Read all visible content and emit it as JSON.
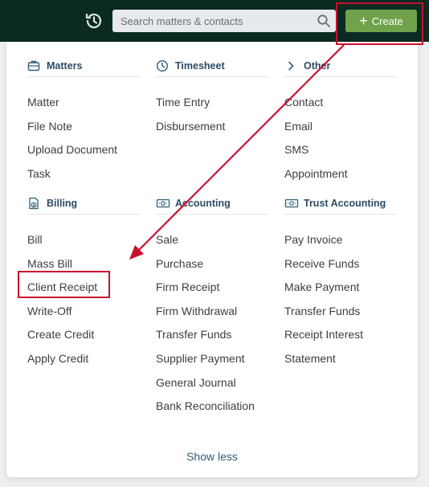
{
  "header": {
    "search_placeholder": "Search matters & contacts",
    "create_label": "Create"
  },
  "sections": {
    "matters": {
      "title": "Matters",
      "icon": "briefcase-icon",
      "items": [
        "Matter",
        "File Note",
        "Upload Document",
        "Task"
      ]
    },
    "timesheet": {
      "title": "Timesheet",
      "icon": "clock-icon",
      "items": [
        "Time Entry",
        "Disbursement"
      ]
    },
    "other": {
      "title": "Other",
      "icon": "chevron-right-icon",
      "items": [
        "Contact",
        "Email",
        "SMS",
        "Appointment"
      ]
    },
    "billing": {
      "title": "Billing",
      "icon": "invoice-dollar-icon",
      "items": [
        "Bill",
        "Mass Bill",
        "Client Receipt",
        "Write-Off",
        "Create Credit",
        "Apply Credit"
      ]
    },
    "accounting": {
      "title": "Accounting",
      "icon": "banknote-icon",
      "items": [
        "Sale",
        "Purchase",
        "Firm Receipt",
        "Firm Withdrawal",
        "Transfer Funds",
        "Supplier Payment",
        "General Journal",
        "Bank Reconciliation"
      ]
    },
    "trust": {
      "title": "Trust Accounting",
      "icon": "banknote-icon",
      "items": [
        "Pay Invoice",
        "Receive Funds",
        "Make Payment",
        "Transfer Funds",
        "Receipt Interest",
        "Statement"
      ]
    }
  },
  "footer": {
    "show_less": "Show less"
  },
  "colors": {
    "topbar": "#0b2a22",
    "create_button": "#6fa24b",
    "annotation": "#c8102e",
    "heading": "#2d4a63"
  }
}
